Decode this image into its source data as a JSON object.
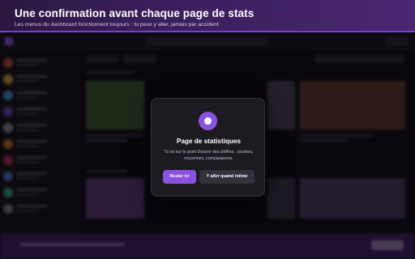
{
  "banner": {
    "title": "Une confirmation avant chaque page de stats",
    "subtitle": "Les menus du dashboard fonctionnent toujours : tu peux y aller, jamais par accident"
  },
  "modal": {
    "icon": "record-dot-icon",
    "title": "Page de statistiques",
    "body": "Tu es sur le point d'ouvrir des chiffres : courbes, moyennes, comparaisons.",
    "primary_label": "Rester ici",
    "secondary_label": "Y aller quand même"
  },
  "colors": {
    "accent": "#8a52e0",
    "banner_border": "#7a3ed0",
    "modal_bg": "#1d1b22",
    "secondary_button": "#34313b"
  }
}
